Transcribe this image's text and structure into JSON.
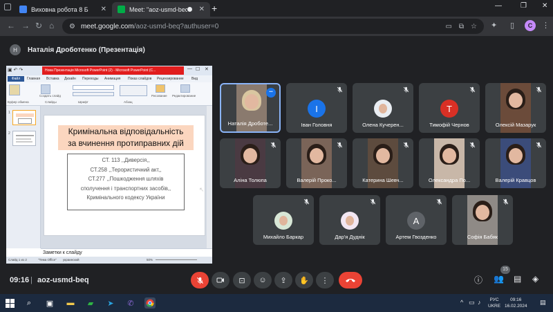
{
  "browser": {
    "tabs": [
      {
        "title": "Виховна робота 8 Б",
        "active": false
      },
      {
        "title": "Meet: \"aoz-usmd-beq\"",
        "active": true
      }
    ],
    "url_host": "meet.google.com",
    "url_path": "/aoz-usmd-beq?authuser=0",
    "profile_initial": "C"
  },
  "meet": {
    "presenter_initial": "Н",
    "presenter_label": "Наталія Дроботенко (Презентація)",
    "clock": "09:16",
    "separator": "|",
    "meeting_code": "aoz-usmd-beq",
    "participant_count": "15"
  },
  "ppt": {
    "window_title": "Нова Презентація Microsoft PowerPoint (2) - Microsoft PowerPoint (С...",
    "tabs": [
      "Файл",
      "Главная",
      "Вставка",
      "Дизайн",
      "Переходы",
      "Анимация",
      "Показ слайдов",
      "Рецензирование",
      "Вид"
    ],
    "groups": [
      "Буфер обмена",
      "Слайды",
      "Шрифт",
      "Абзац",
      "Рисование",
      "Редактирование"
    ],
    "ribbon_labels": [
      "Вставить",
      "Создать слайд",
      "Рисование",
      "Редактирование"
    ],
    "slide_title_1": "Кримінальна відповідальність",
    "slide_title_2": "за вчинення протиправних дій",
    "slide_lines": [
      "СТ. 113 ,,Диверсія,,",
      "СТ.258 ,,Терористичний акт,,",
      "СТ.277 ,,Пошкодження шляхів",
      "сполучення і транспортних засобів,,",
      "Кримінального кодексу України"
    ],
    "notes": "Заметки к слайду",
    "status_left": "Слайд 1 из 2",
    "status_theme": "\"Тема Office\"",
    "status_lang": "украинский",
    "zoom": "50%"
  },
  "participants": [
    {
      "name": "Наталія Дроботе...",
      "kind": "video",
      "speaking": true
    },
    {
      "name": "Іван Головня",
      "kind": "avatar",
      "initial": "І",
      "color": "#1a73e8"
    },
    {
      "name": "Олена Кучерен...",
      "kind": "photo"
    },
    {
      "name": "Тимофій Чернов",
      "kind": "avatar",
      "initial": "Т",
      "color": "#d93025"
    },
    {
      "name": "Олексій Мазарук",
      "kind": "video"
    },
    {
      "name": "Аліна Толюпа",
      "kind": "video"
    },
    {
      "name": "Валерій Проко...",
      "kind": "video"
    },
    {
      "name": "Катерина Шевч...",
      "kind": "video"
    },
    {
      "name": "Олександра По...",
      "kind": "video"
    },
    {
      "name": "Валерій Кравцов",
      "kind": "video"
    },
    {
      "name": "Михайло Баркар",
      "kind": "photo"
    },
    {
      "name": "Дар'я Дуднік",
      "kind": "photo"
    },
    {
      "name": "Артем Гвозденко",
      "kind": "avatar",
      "initial": "А",
      "color": "#5f6368"
    },
    {
      "name": "Софія Бабяк",
      "kind": "video"
    }
  ],
  "taskbar": {
    "lang_1": "РУС",
    "lang_2": "UKRE",
    "time": "09:16",
    "date": "16.02.2024"
  },
  "colors": {
    "accent": "#8ab4f8",
    "end_call": "#ea4335",
    "muted": "#ea4335"
  }
}
